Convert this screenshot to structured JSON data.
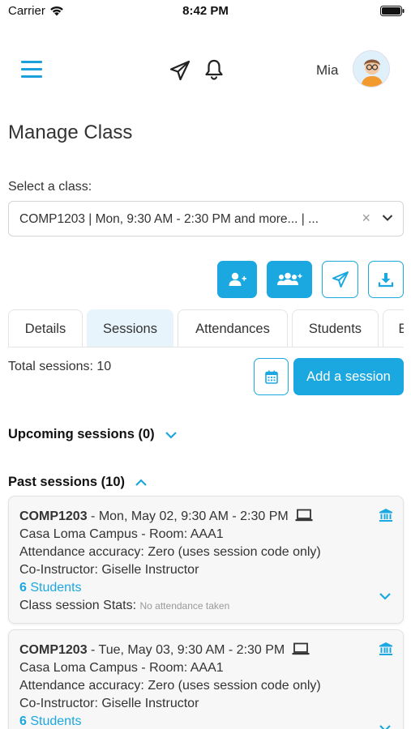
{
  "status_bar": {
    "carrier": "Carrier",
    "time": "8:42 PM"
  },
  "header": {
    "user_name": "Mia"
  },
  "page": {
    "title": "Manage Class"
  },
  "class_select": {
    "label": "Select a class:",
    "value": "COMP1203 | Mon, 9:30 AM - 2:30 PM and more... | ..."
  },
  "actions": [
    "add-student-icon",
    "add-group-icon",
    "send-icon",
    "download-icon"
  ],
  "tabs": [
    {
      "label": "Details",
      "active": false
    },
    {
      "label": "Sessions",
      "active": true
    },
    {
      "label": "Attendances",
      "active": false
    },
    {
      "label": "Students",
      "active": false
    },
    {
      "label": "E",
      "active": false
    }
  ],
  "sessions": {
    "total_text": "Total sessions: 10",
    "add_button": "Add a session",
    "upcoming_header": "Upcoming sessions (0)",
    "past_header": "Past sessions (10)"
  },
  "past_sessions": [
    {
      "course": "COMP1203",
      "datetime": " - Mon, May 02, 9:30 AM - 2:30 PM",
      "location": "Casa Loma Campus - Room: AAA1",
      "accuracy": "Attendance accuracy: Zero (uses session code only)",
      "instructor": "Co-Instructor: Giselle Instructor",
      "students_count": "6",
      "students_label": " Students",
      "stats_label": "Class session Stats: ",
      "stats_value": "No attendance taken"
    },
    {
      "course": "COMP1203",
      "datetime": " - Tue, May 03, 9:30 AM - 2:30 PM",
      "location": "Casa Loma Campus - Room: AAA1",
      "accuracy": "Attendance accuracy: Zero (uses session code only)",
      "instructor": "Co-Instructor: Giselle Instructor",
      "students_count": "6",
      "students_label": " Students"
    }
  ],
  "colors": {
    "accent": "#1ba8e0",
    "tab_active_bg": "#e8f4fb",
    "card_bg": "#f7f7f7"
  }
}
